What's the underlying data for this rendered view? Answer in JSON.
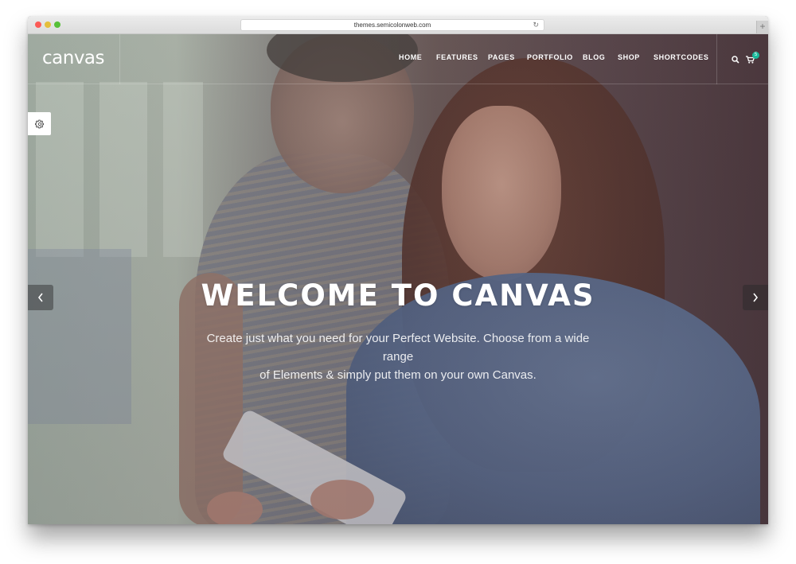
{
  "browser": {
    "url": "themes.semicolonweb.com",
    "reload_icon": "reload-icon",
    "new_tab_label": "+"
  },
  "header": {
    "logo": "canvas",
    "nav": [
      {
        "label": "HOME"
      },
      {
        "label": "FEATURES"
      },
      {
        "label": "PAGES"
      },
      {
        "label": "PORTFOLIO"
      },
      {
        "label": "BLOG"
      },
      {
        "label": "SHOP"
      },
      {
        "label": "SHORTCODES"
      }
    ],
    "search_icon": "search-icon",
    "cart_icon": "cart-icon",
    "cart_count": "5"
  },
  "settings_icon": "gear-icon",
  "slider": {
    "title": "WELCOME TO CANVAS",
    "subtitle_line1": "Create just what you need for your Perfect Website. Choose from a wide range",
    "subtitle_line2": "of Elements & simply put them on your own Canvas.",
    "prev_icon": "chevron-left-icon",
    "next_icon": "chevron-right-icon"
  },
  "colors": {
    "accent": "#1abc9c",
    "traffic_red": "#fc5b57",
    "traffic_yellow": "#e5bf3c",
    "traffic_green": "#57c038"
  }
}
